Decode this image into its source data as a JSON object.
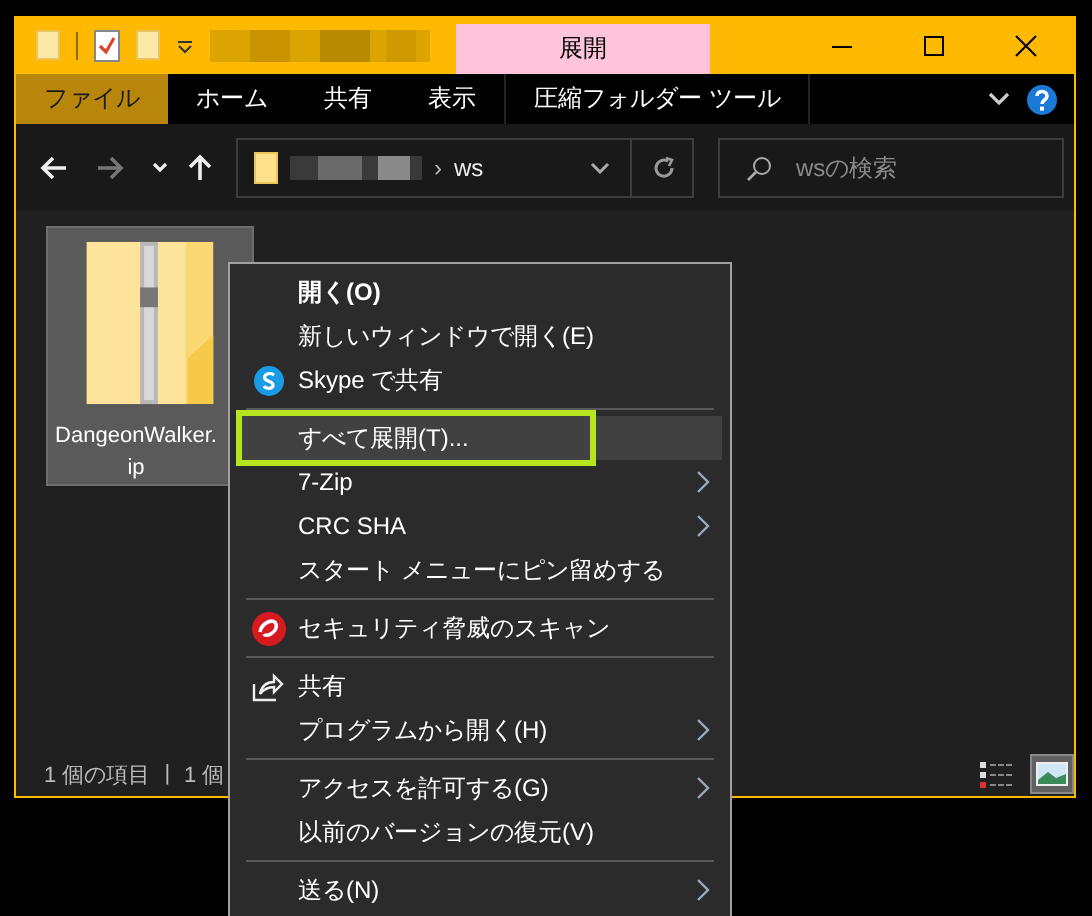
{
  "title_bar": {
    "context_tab": "展開"
  },
  "ribbon": {
    "tabs": [
      {
        "label": "ファイル",
        "selected": true
      },
      {
        "label": "ホーム",
        "selected": false
      },
      {
        "label": "共有",
        "selected": false
      },
      {
        "label": "表示",
        "selected": false
      },
      {
        "label": "圧縮フォルダー ツール",
        "selected": false
      }
    ]
  },
  "nav": {
    "buttons": [
      {
        "kind": "back",
        "disabled": false
      },
      {
        "kind": "forward",
        "disabled": true
      },
      {
        "kind": "recent",
        "disabled": false
      },
      {
        "kind": "up",
        "disabled": false
      }
    ],
    "address": {
      "separator": "›",
      "folder": "ws"
    },
    "search": {
      "placeholder": "wsの検索"
    }
  },
  "file": {
    "label_lines": [
      "DangeonWalker.",
      "ip"
    ],
    "selected": true
  },
  "status_bar": {
    "items_count": "1 個の項目",
    "divider": "|",
    "selected_count": "1 個",
    "views": [
      {
        "kind": "details",
        "selected": false
      },
      {
        "kind": "large-icons",
        "selected": true
      }
    ]
  },
  "context_menu": {
    "items": [
      {
        "kind": "item",
        "label": "開く(O)",
        "selected": false,
        "bold": true
      },
      {
        "kind": "item",
        "label": "新しいウィンドウで開く(E)",
        "selected": false,
        "bold": false
      },
      {
        "kind": "skype-item",
        "label": "Skype で共有",
        "selected": false,
        "bold": false
      },
      {
        "kind": "separator"
      },
      {
        "kind": "item",
        "label": "すべて展開(T)...",
        "selected": true,
        "bold": false
      },
      {
        "kind": "submenu",
        "label": "7-Zip",
        "selected": false,
        "bold": false
      },
      {
        "kind": "submenu",
        "label": "CRC SHA",
        "selected": false,
        "bold": false
      },
      {
        "kind": "item",
        "label": "スタート メニューにピン留めする",
        "selected": false,
        "bold": false
      },
      {
        "kind": "separator"
      },
      {
        "kind": "scan-item",
        "label": "セキュリティ脅威のスキャン",
        "selected": false,
        "bold": false
      },
      {
        "kind": "separator"
      },
      {
        "kind": "share-item",
        "label": "共有",
        "selected": false,
        "bold": false
      },
      {
        "kind": "submenu",
        "label": "プログラムから開く(H)",
        "selected": false,
        "bold": false
      },
      {
        "kind": "separator"
      },
      {
        "kind": "submenu",
        "label": "アクセスを許可する(G)",
        "selected": false,
        "bold": false
      },
      {
        "kind": "item",
        "label": "以前のバージョンの復元(V)",
        "selected": false,
        "bold": false
      },
      {
        "kind": "separator"
      },
      {
        "kind": "submenu",
        "label": "送る(N)",
        "selected": false,
        "bold": false
      }
    ]
  }
}
